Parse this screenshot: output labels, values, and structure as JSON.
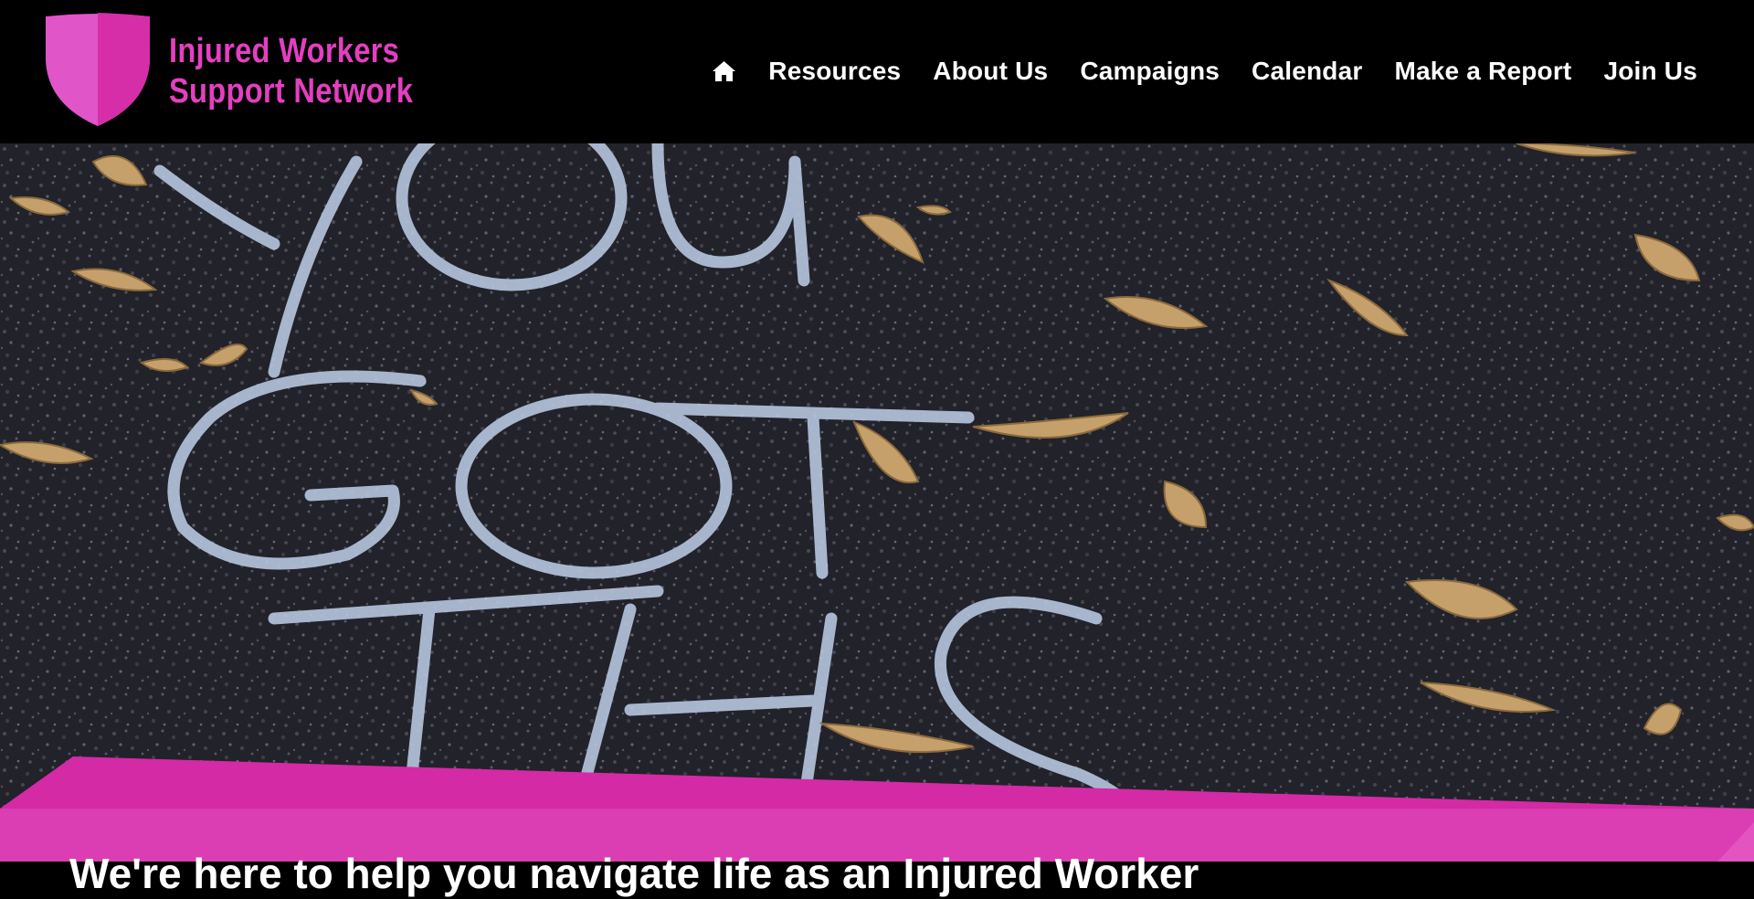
{
  "site": {
    "logo_line1": "Injured Workers",
    "logo_line2": "Support Network",
    "brand_color": "#e43fc0",
    "shield_icon": "shield-icon"
  },
  "nav": {
    "home_icon": "home-icon",
    "items": [
      {
        "label": "Resources"
      },
      {
        "label": "About Us"
      },
      {
        "label": "Campaigns"
      },
      {
        "label": "Calendar"
      },
      {
        "label": "Make a Report"
      },
      {
        "label": "Join Us"
      }
    ]
  },
  "hero": {
    "chalk_text": "YOU GOT THIS",
    "band_color": "#d42aa6"
  },
  "tagline": "We're here to help you navigate life as an Injured Worker"
}
